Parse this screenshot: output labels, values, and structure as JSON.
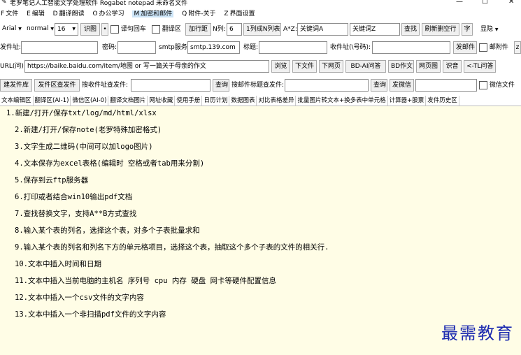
{
  "window": {
    "title": "老罗笔记人工智能文字处理软件 Rogabet notepad  未命名文件",
    "controls": [
      "—",
      "☐",
      "✕"
    ]
  },
  "menu": [
    {
      "key": "F",
      "label": "文件"
    },
    {
      "key": "E",
      "label": "编辑"
    },
    {
      "key": "D",
      "label": "翻译朗读"
    },
    {
      "key": "O",
      "label": "办公学习"
    },
    {
      "key": "M",
      "label": "加密和邮件"
    },
    {
      "key": "Q",
      "label": "附件-关于"
    },
    {
      "key": "Z",
      "label": "界面设置"
    }
  ],
  "toolbar1": {
    "font": "Arial",
    "style": "normal",
    "size": "16",
    "recognize": "识图",
    "wrap_label": "译句回车",
    "translate_label": "翻译区",
    "line_spacing": "加行距",
    "n_col_label": "N列:",
    "n_col_value": "6",
    "one_to_n": "1列成N列表",
    "az_label": "A*Z:",
    "keyword_a": "关键词A",
    "keyword_z": "关键词Z",
    "find": "查找",
    "refresh": "刷新删空行",
    "char": "字",
    "show": "显隐"
  },
  "toolbar2": {
    "sender_label": "发件址:",
    "password_label": "密码:",
    "smtp_label": "smtp服务",
    "smtp_value": "smtp.139.com",
    "subject_label": "标题:",
    "recipient_label": "收件址(\\号码):",
    "send_mail": "发邮件",
    "attach_label": "邮附件",
    "z": "z"
  },
  "toolbar3": {
    "url_label": "URL(问)",
    "url_value": "https://baike.baidu.com/item/地图 or 写一篇关于母亲的作文",
    "buttons": [
      "浏览",
      "下文件",
      "下网页",
      "BD-AI问答",
      "BD作文",
      "网页图",
      "识音",
      "<-TL问答"
    ]
  },
  "toolbar4": {
    "build_lib": "建发件库",
    "find_sender": "发件区查发件",
    "search_recipient_label": "搜收件址查发件:",
    "query": "查询",
    "search_subject_label": "搜邮件标题查发件:",
    "query2": "查询",
    "send_wechat": "发微信",
    "wechat_file_label": "微信文件"
  },
  "tabs": [
    "文本编辑区",
    "翻译区(AI-1)",
    "微信区(AI-0)",
    "翻译文档图片",
    "网址收藏",
    "使用手册",
    "日历计划",
    "数据图表",
    "对比表格差异",
    "批量图片转文本+换多表中单元格",
    "计算器+股票",
    "发件历史区"
  ],
  "editor_lines": [
    "1.新建/打开/保存txt/log/md/html/xlsx",
    "2.新建/打开/保存note(老罗特殊加密格式)",
    "3.文字生成二维码(中间可以加logo图片)",
    "4.文本保存为excel表格(编辑时 空格或者tab用来分割)",
    "5.保存到云ftp服务器",
    "6.打印或者结合win10输出pdf文档",
    "7.查找替换文字，支持A**B方式查找",
    "8.输入某个表的列名，选择这个表，对多个子表批量求和",
    "9.输入某个表的列名和列名下方的单元格项目，选择这个表，抽取这个多个子表的文件的相关行.",
    "10.文本中插入时间和日期",
    "11.文本中插入当前电脑的主机名 序列号 cpu 内存 硬盘 网卡等硬件配置信息",
    "12.文本中插入一个csv文件的文字内容",
    "13.文本中插入一个非扫描pdf文件的文字内容"
  ],
  "watermark": "最需教育"
}
